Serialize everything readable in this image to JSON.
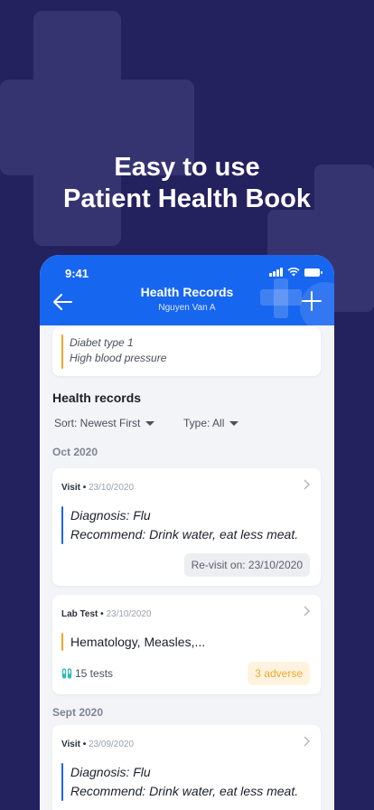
{
  "promo": {
    "line1": "Easy to use",
    "line2": "Patient Health Book"
  },
  "status_bar": {
    "time": "9:41"
  },
  "header": {
    "title": "Health Records",
    "subtitle": "Nguyen Van A",
    "accent_color": "#1766f0"
  },
  "conditions": [
    "Diabet type 1",
    "High blood pressure"
  ],
  "records_section": {
    "title": "Health records",
    "sort_label": "Sort: Newest First",
    "type_label": "Type: All"
  },
  "groups": [
    {
      "label": "Oct 2020",
      "records": [
        {
          "type": "Visit",
          "date": "23/10/2020",
          "line1": "Diagnosis: Flu",
          "line2": "Recommend: Drink water, eat less meat.",
          "revisit": "Re-visit on: 23/10/2020"
        },
        {
          "type": "Lab Test",
          "date": "23/10/2020",
          "line1": "Hematology, Measles,...",
          "tests": "15 tests",
          "adverse": "3 adverse"
        }
      ]
    },
    {
      "label": "Sept 2020",
      "records": [
        {
          "type": "Visit",
          "date": "23/09/2020",
          "line1": "Diagnosis: Flu",
          "line2": "Recommend: Drink water, eat less meat."
        }
      ]
    }
  ],
  "colors": {
    "background": "#24215f",
    "visit_bar": "#1766f0",
    "lab_bar": "#f5a623",
    "adverse": "#f5a623"
  },
  "icons": {
    "back": "back-arrow-icon",
    "add": "plus-icon",
    "chevron": "chevron-right-icon",
    "tests": "test-tubes-icon"
  }
}
